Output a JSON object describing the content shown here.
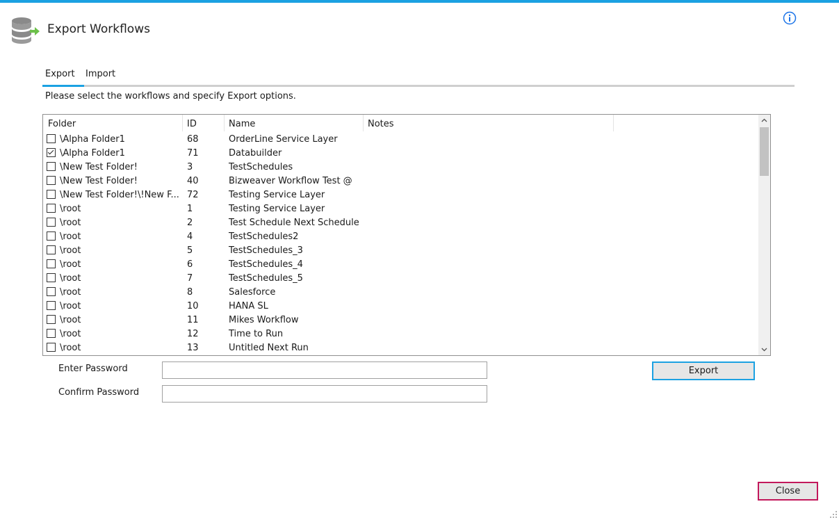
{
  "window": {
    "title": "Export Workflows"
  },
  "tabs": [
    {
      "label": "Export",
      "active": true
    },
    {
      "label": "Import",
      "active": false
    }
  ],
  "instruction": "Please select the workflows and specify Export options.",
  "grid": {
    "columns": [
      "Folder",
      "ID",
      "Name",
      "Notes"
    ],
    "rows": [
      {
        "checked": false,
        "folder": "\\Alpha Folder1",
        "id": "68",
        "name": "OrderLine Service Layer"
      },
      {
        "checked": true,
        "folder": "\\Alpha Folder1",
        "id": "71",
        "name": "Databuilder"
      },
      {
        "checked": false,
        "folder": "\\New Test Folder!",
        "id": "3",
        "name": "TestSchedules"
      },
      {
        "checked": false,
        "folder": "\\New Test Folder!",
        "id": "40",
        "name": "Bizweaver Workflow Test @"
      },
      {
        "checked": false,
        "folder": "\\New Test Folder!\\!New F...",
        "id": "72",
        "name": "Testing Service Layer"
      },
      {
        "checked": false,
        "folder": "\\root",
        "id": "1",
        "name": "Testing Service Layer"
      },
      {
        "checked": false,
        "folder": "\\root",
        "id": "2",
        "name": "Test Schedule Next Schedule"
      },
      {
        "checked": false,
        "folder": "\\root",
        "id": "4",
        "name": "TestSchedules2"
      },
      {
        "checked": false,
        "folder": "\\root",
        "id": "5",
        "name": "TestSchedules_3"
      },
      {
        "checked": false,
        "folder": "\\root",
        "id": "6",
        "name": "TestSchedules_4"
      },
      {
        "checked": false,
        "folder": "\\root",
        "id": "7",
        "name": "TestSchedules_5"
      },
      {
        "checked": false,
        "folder": "\\root",
        "id": "8",
        "name": "Salesforce"
      },
      {
        "checked": false,
        "folder": "\\root",
        "id": "10",
        "name": "HANA SL"
      },
      {
        "checked": false,
        "folder": "\\root",
        "id": "11",
        "name": "Mikes Workflow"
      },
      {
        "checked": false,
        "folder": "\\root",
        "id": "12",
        "name": "Time to Run"
      },
      {
        "checked": false,
        "folder": "\\root",
        "id": "13",
        "name": "Untitled Next Run"
      }
    ]
  },
  "form": {
    "password_label": "Enter Password",
    "password_value": "",
    "confirm_label": "Confirm Password",
    "confirm_value": ""
  },
  "buttons": {
    "export": "Export",
    "close": "Close"
  },
  "colors": {
    "accent": "#1ba1e2",
    "close_border": "#c2185b",
    "export_arrow": "#6cc04a"
  },
  "icons": {
    "app": "database-export-icon",
    "info": "info-icon"
  }
}
